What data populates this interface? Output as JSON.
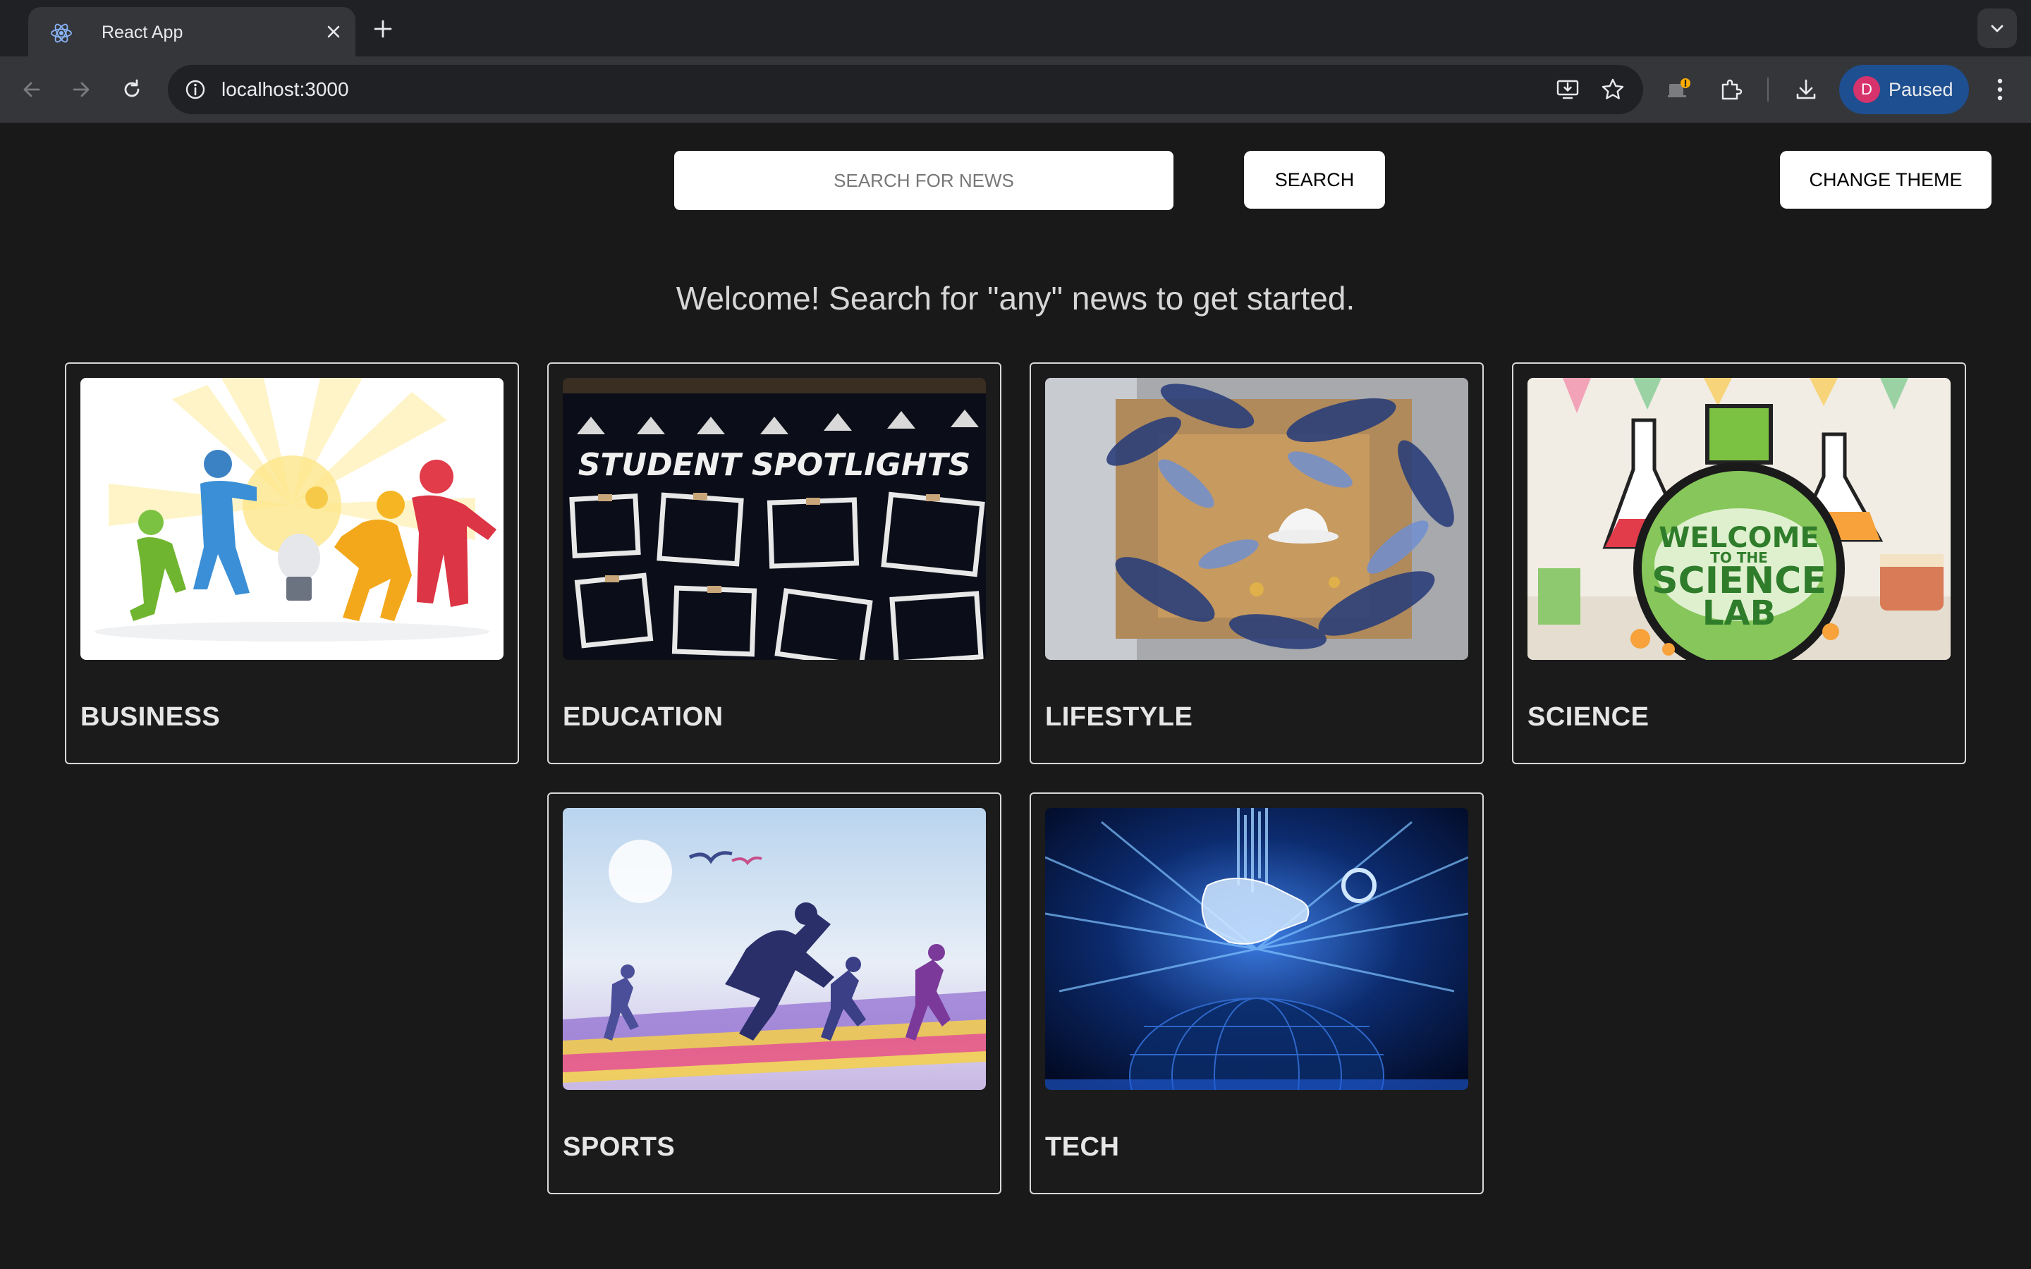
{
  "browser": {
    "tab_title": "React App",
    "url": "localhost:3000",
    "profile_initial": "D",
    "profile_status": "Paused"
  },
  "search": {
    "placeholder": "SEARCH FOR NEWS",
    "button_label": "SEARCH"
  },
  "theme": {
    "button_label": "CHANGE THEME"
  },
  "welcome_text": "Welcome! Search for \"any\" news to get started.",
  "categories": [
    {
      "label": "BUSINESS"
    },
    {
      "label": "EDUCATION",
      "image_text": "STUDENT SPOTLIGHTS"
    },
    {
      "label": "LIFESTYLE"
    },
    {
      "label": "SCIENCE",
      "image_text_1": "WELCOME",
      "image_text_2": "TO THE",
      "image_text_3": "SCIENCE",
      "image_text_4": "LAB"
    },
    {
      "label": "SPORTS"
    },
    {
      "label": "TECH"
    }
  ],
  "colors": {
    "page_background": "#191919",
    "card_border": "#d8d8d8",
    "profile_chip": "#1d4f91",
    "avatar": "#d6336c"
  }
}
